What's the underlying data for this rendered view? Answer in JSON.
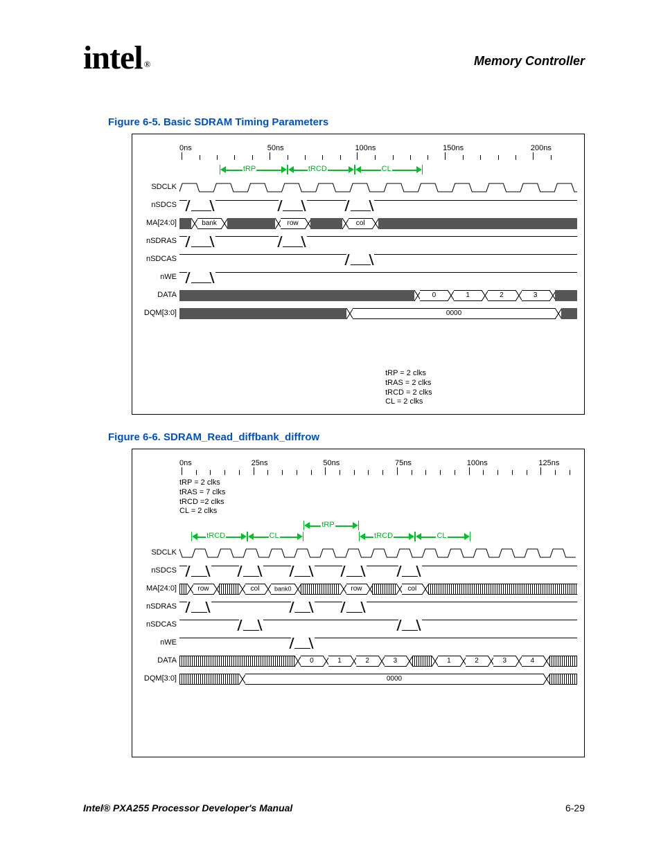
{
  "header": {
    "logo_text": "intel",
    "reg": "®",
    "section": "Memory Controller"
  },
  "figures": {
    "a": {
      "caption": "Figure 6-5. Basic SDRAM Timing Parameters",
      "time_labels": [
        "0ns",
        "50ns",
        "100ns",
        "150ns",
        "200ns"
      ],
      "annotations": [
        "tRP",
        "tRCD",
        "CL"
      ],
      "signals": [
        "SDCLK",
        "nSDCS",
        "MA[24:0]",
        "nSDRAS",
        "nSDCAS",
        "nWE",
        "DATA",
        "DQM[3:0]"
      ],
      "ma_vals": [
        "bank",
        "row",
        "col"
      ],
      "data_vals": [
        "0",
        "1",
        "2",
        "3"
      ],
      "dqm_val": "0000",
      "params": {
        "line1": "tRP = 2 clks",
        "line2": "tRAS = 2 clks",
        "line3": "tRCD = 2 clks",
        "line4": "CL = 2 clks"
      }
    },
    "b": {
      "caption": "Figure 6-6. SDRAM_Read_diffbank_diffrow",
      "time_labels": [
        "0ns",
        "25ns",
        "50ns",
        "75ns",
        "100ns",
        "125ns"
      ],
      "params": {
        "line1": "tRP = 2 clks",
        "line2": "tRAS = 7 clks",
        "line3": "tRCD =2 clks",
        "line4": "CL = 2 clks"
      },
      "annotations_top": [
        "tRP"
      ],
      "annotations_bot": [
        "tRCD",
        "CL",
        "tRCD",
        "CL"
      ],
      "signals": [
        "SDCLK",
        "nSDCS",
        "MA[24:0]",
        "nSDRAS",
        "nSDCAS",
        "nWE",
        "DATA",
        "DQM[3:0]"
      ],
      "ma_vals": [
        "row",
        "col",
        "bank0",
        "row",
        "col"
      ],
      "data_vals1": [
        "0",
        "1",
        "2",
        "3"
      ],
      "data_vals2": [
        "1",
        "2",
        "3",
        "4"
      ],
      "dqm_val": "0000"
    }
  },
  "footer": {
    "title": "Intel® PXA255 Processor Developer's Manual",
    "page": "6-29"
  }
}
